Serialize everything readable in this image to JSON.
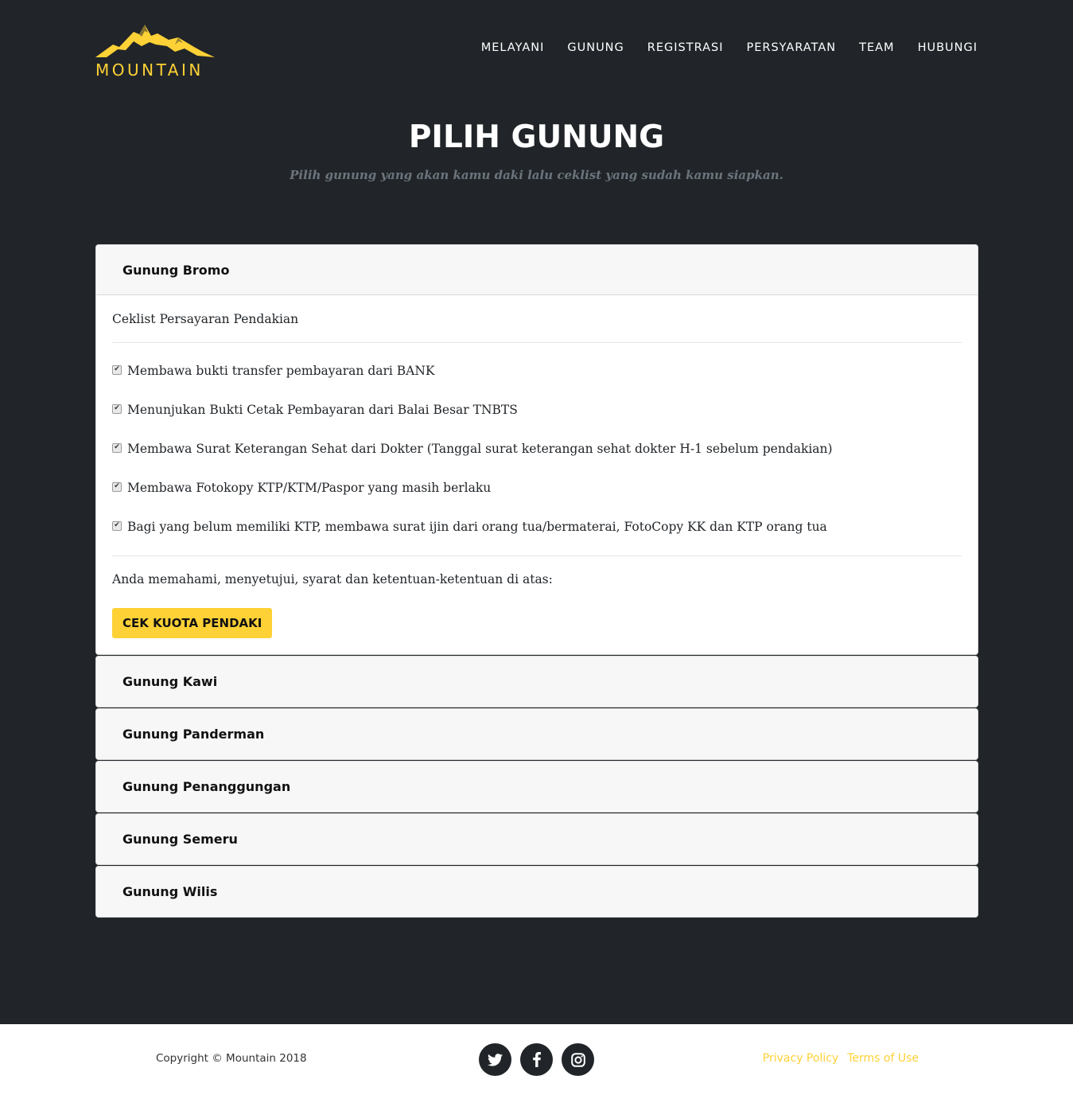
{
  "brand": {
    "name": "MOUNTAIN",
    "color": "#fed136"
  },
  "nav": {
    "items": [
      "MELAYANI",
      "GUNUNG",
      "REGISTRASI",
      "PERSYARATAN",
      "TEAM",
      "HUBUNGI"
    ]
  },
  "section": {
    "title": "PILIH GUNUNG",
    "subtitle": "Pilih gunung yang akan kamu daki lalu ceklist yang sudah kamu siapkan."
  },
  "accordion": {
    "open_panel": {
      "title": "Gunung Bromo",
      "intro": "Ceklist Persayaran Pendakian",
      "checklist": [
        "Membawa bukti transfer pembayaran dari BANK",
        "Menunjukan Bukti Cetak Pembayaran dari Balai Besar TNBTS",
        "Membawa Surat Keterangan Sehat dari Dokter (Tanggal surat keterangan sehat dokter H-1 sebelum pendakian)",
        "Membawa Fotokopy KTP/KTM/Paspor yang masih berlaku",
        "Bagi yang belum memiliki KTP, membawa surat ijin dari orang tua/bermaterai, FotoCopy KK dan KTP orang tua"
      ],
      "checked": [
        true,
        true,
        true,
        true,
        true
      ],
      "agreement": "Anda memahami, menyetujui, syarat dan ketentuan-ketentuan di atas:",
      "button": "CEK KUOTA PENDAKI"
    },
    "collapsed_panels": [
      "Gunung Kawi",
      "Gunung Panderman",
      "Gunung Penanggungan",
      "Gunung Semeru",
      "Gunung Wilis"
    ]
  },
  "footer": {
    "copyright": "Copyright © Mountain 2018",
    "social": [
      "twitter-icon",
      "facebook-icon",
      "instagram-icon"
    ],
    "links": [
      "Privacy Policy",
      "Terms of Use"
    ]
  }
}
